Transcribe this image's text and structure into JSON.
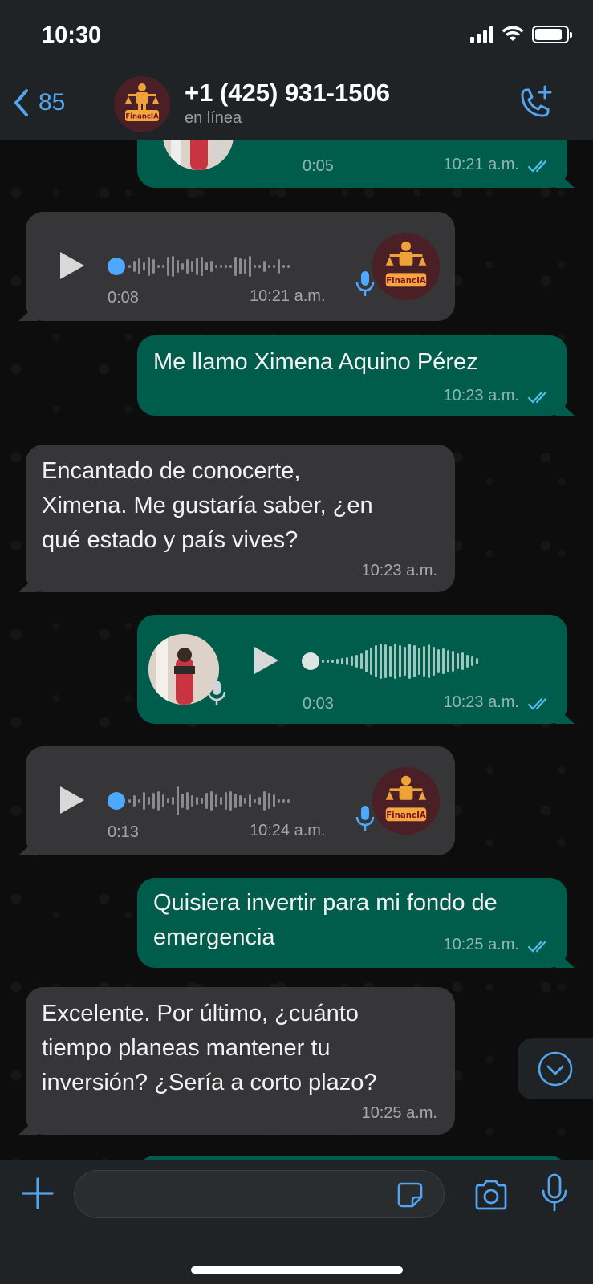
{
  "status_bar": {
    "time": "10:30"
  },
  "header": {
    "back_count": "85",
    "contact_name": "+1 (425) 931-1506",
    "contact_status": "en línea",
    "avatar_label": "FinancIA"
  },
  "messages": [
    {
      "type": "voice",
      "direction": "out",
      "duration": "0:05",
      "time": "10:21 a.m.",
      "read": true
    },
    {
      "type": "voice",
      "direction": "in",
      "duration": "0:08",
      "time": "10:21 a.m.",
      "avatar_label": "FinancIA"
    },
    {
      "type": "text",
      "direction": "out",
      "text": "Me llamo Ximena Aquino Pérez",
      "time": "10:23 a.m.",
      "read": true
    },
    {
      "type": "text",
      "direction": "in",
      "lines": [
        "Encantado de conocerte,",
        "Ximena. Me gustaría saber, ¿en",
        "qué estado y país vives?"
      ],
      "time": "10:23 a.m."
    },
    {
      "type": "voice",
      "direction": "out",
      "duration": "0:03",
      "time": "10:23 a.m.",
      "read": true
    },
    {
      "type": "voice",
      "direction": "in",
      "duration": "0:13",
      "time": "10:24 a.m.",
      "avatar_label": "FinancIA"
    },
    {
      "type": "text",
      "direction": "out",
      "lines": [
        "Quisiera invertir para mi fondo de",
        "emergencia"
      ],
      "time": "10:25 a.m.",
      "read": true
    },
    {
      "type": "text",
      "direction": "in",
      "lines": [
        "Excelente. Por último, ¿cuánto",
        "tiempo planeas mantener tu",
        "inversión? ¿Sería a corto plazo?"
      ],
      "time": "10:25 a.m."
    }
  ],
  "footer": {
    "input_placeholder": ""
  },
  "colors": {
    "accent": "#53a5ef",
    "bubble_out": "#005c4b",
    "bubble_in": "#363638",
    "tick_read": "#53bdeb",
    "voice_dot": "#4ea8ff"
  },
  "icons": [
    "back-chevron-icon",
    "add-call-icon",
    "play-icon",
    "mic-icon",
    "double-check-icon",
    "plus-icon",
    "sticker-icon",
    "camera-icon",
    "chevron-down-icon"
  ]
}
